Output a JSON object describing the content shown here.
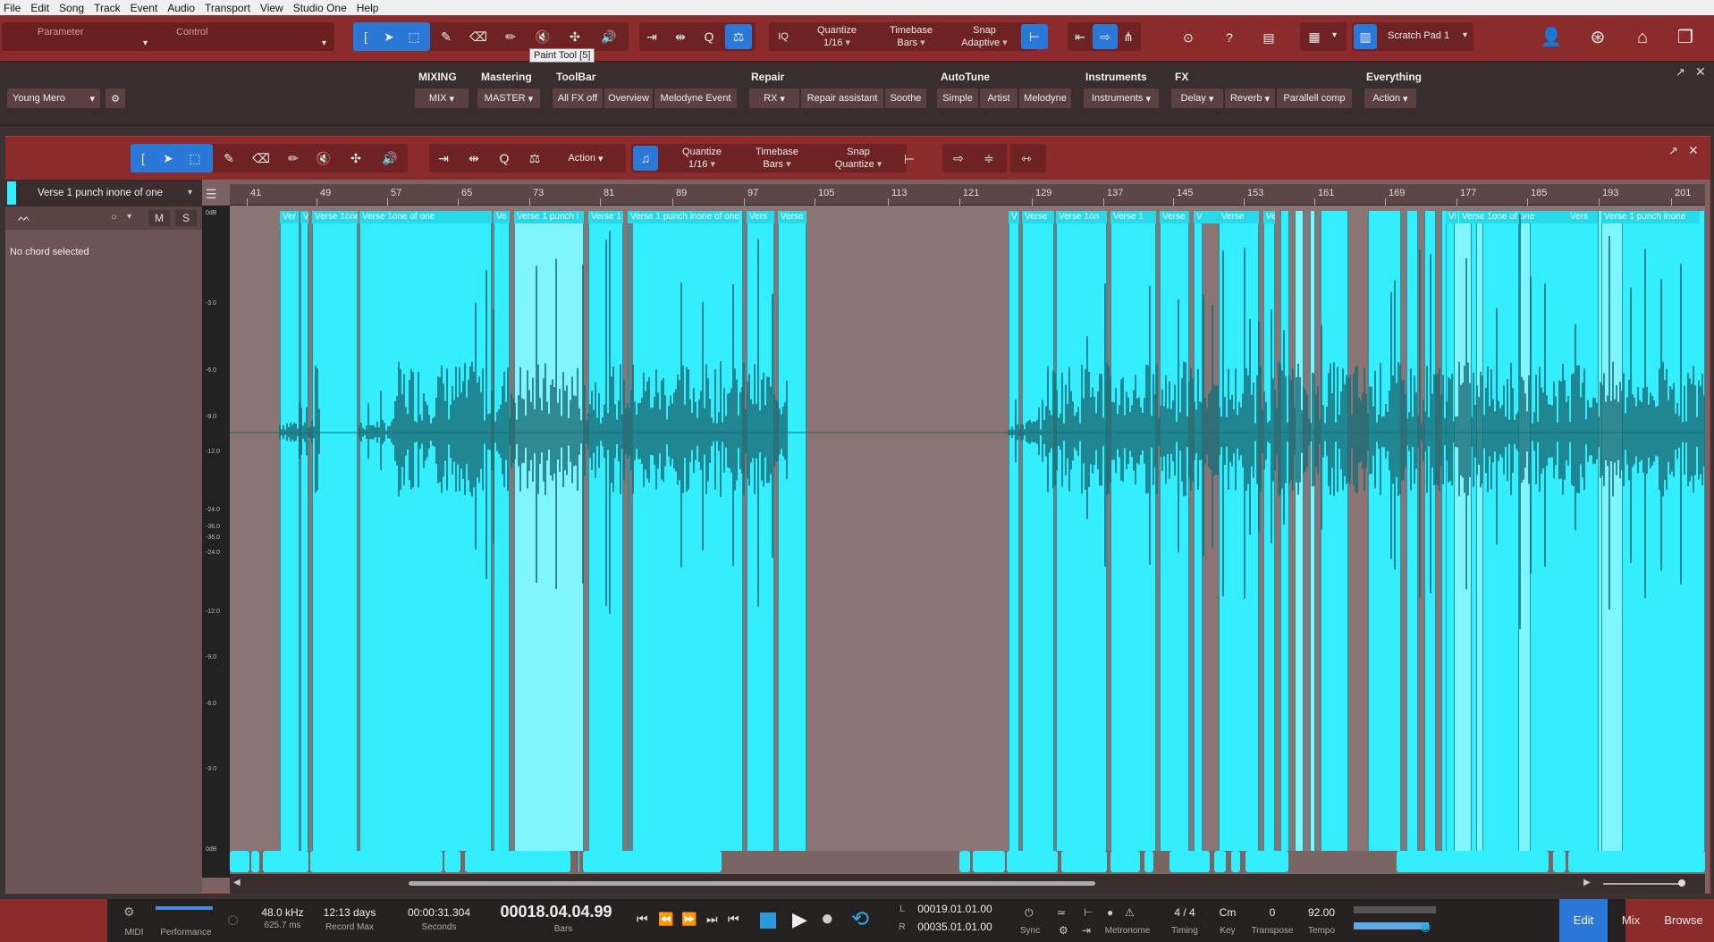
{
  "menu": [
    "File",
    "Edit",
    "Song",
    "Track",
    "Event",
    "Audio",
    "Transport",
    "View",
    "Studio One",
    "Help"
  ],
  "toolbar": {
    "parameter": "Parameter",
    "control": "Control",
    "quantize_label": "Quantize",
    "quantize_value": "1/16",
    "timebase_label": "Timebase",
    "timebase_value": "Bars",
    "snap_label": "Snap",
    "snap_value": "Adaptive",
    "iq": "IQ",
    "scratch_pad": "Scratch Pad 1",
    "tooltip": "Paint Tool [5]"
  },
  "macro": {
    "preset": "Young Mero",
    "groups": [
      {
        "title": "MIXING",
        "buttons": [
          "MIX"
        ]
      },
      {
        "title": "Mastering",
        "buttons": [
          "MASTER"
        ]
      },
      {
        "title": "ToolBar",
        "buttons": [
          "All FX off",
          "Overview",
          "Melodyne Event"
        ]
      },
      {
        "title": "Repair",
        "buttons": [
          "RX",
          "Repair assistant",
          "Soothe"
        ]
      },
      {
        "title": "AutoTune",
        "buttons": [
          "Simple",
          "Artist",
          "Melodyne"
        ]
      },
      {
        "title": "Instruments",
        "buttons": [
          "Instruments"
        ]
      },
      {
        "title": "FX",
        "buttons": [
          "Delay",
          "Reverb",
          "Parallell comp"
        ]
      },
      {
        "title": "Everything",
        "buttons": [
          "Action"
        ]
      }
    ]
  },
  "editor": {
    "action_label": "Action",
    "quantize_label": "Quantize",
    "quantize_value": "1/16",
    "timebase_label": "Timebase",
    "timebase_value": "Bars",
    "snap_label": "Snap",
    "snap_value": "Quantize",
    "track_name": "Verse 1 punch inone of one",
    "mute": "M",
    "solo": "S",
    "chord_status": "No chord selected",
    "ruler": [
      "41",
      "49",
      "57",
      "65",
      "73",
      "81",
      "89",
      "97",
      "105",
      "113",
      "121",
      "129",
      "137",
      "145",
      "153",
      "161",
      "169",
      "177",
      "185",
      "193",
      "201"
    ],
    "db_labels": [
      "0dB",
      "-3.0",
      "-6.0",
      "-9.0",
      "-12.0",
      "-24.0",
      "-36.0",
      "-36.0",
      "-24.0",
      "-12.0",
      "-9.0",
      "-6.0",
      "-3.0",
      "0dB"
    ],
    "clip_labels": [
      "Ver",
      "V",
      "Verse 1one",
      "Verse 1one of one",
      "Ve",
      "Verse 1 punch i",
      "Verse 1",
      "Verse 1 punch inone of one",
      "Vers",
      "Verse",
      "V",
      "Verse",
      "Verse 1on",
      "Verse 1",
      "Verse",
      "V",
      "Verse",
      "Ve",
      "Vi",
      "Verse 1one of one",
      "Vers",
      "Verse 1 punch inone"
    ]
  },
  "transport": {
    "midi": "MIDI",
    "performance": "Performance",
    "sample_rate": "48.0 kHz",
    "latency": "625.7 ms",
    "record_days": "12:13 days",
    "record_max": "Record Max",
    "seconds_value": "00:00:31.304",
    "seconds_label": "Seconds",
    "bars_value": "00018.04.04.99",
    "bars_label": "Bars",
    "loop_l": "00019.01.01.00",
    "loop_r": "00035.01.01.00",
    "l": "L",
    "r": "R",
    "sync": "Sync",
    "metronome": "Metronome",
    "timing_value": "4 / 4",
    "timing_label": "Timing",
    "key_value": "Cm",
    "key_label": "Key",
    "transpose_value": "0",
    "transpose_label": "Transpose",
    "tempo_value": "92.00",
    "tempo_label": "Tempo",
    "edit": "Edit",
    "mix": "Mix",
    "browse": "Browse"
  },
  "colors": {
    "accent": "#2a78d8",
    "toolbar": "#8b2b2c",
    "clip": "#33eeff"
  }
}
